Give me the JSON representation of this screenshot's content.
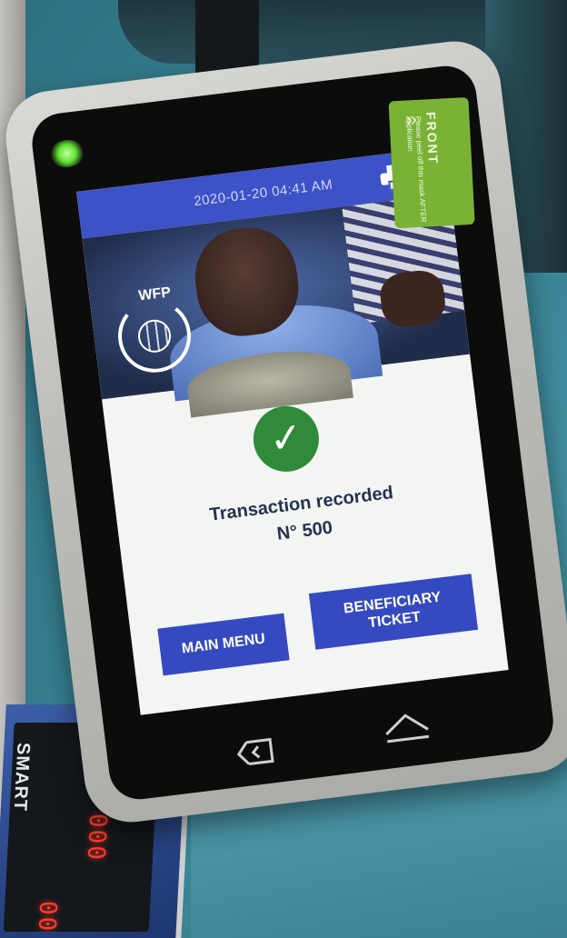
{
  "screen": {
    "datetime": "2020-01-20 04:41 AM",
    "logo_label": "WFP",
    "message": "Transaction recorded",
    "transaction_number": "N° 500",
    "buttons": {
      "main_menu": "MAIN MENU",
      "beneficiary_ticket": "BENEFICIARY TICKET"
    }
  },
  "sticker": {
    "title": "FRONT",
    "subtitle": "Please peel off this mask AFTER application"
  },
  "scale": {
    "brand": "SMART",
    "digits_top": "000",
    "digits_bottom": "00"
  },
  "icons": [
    "printer-icon",
    "check-icon",
    "back-nav-icon",
    "home-nav-icon",
    "wfp-logo-icon",
    "peel-arrow-icon"
  ],
  "colors": {
    "status_bar": "#3d52c6",
    "button": "#3549c0",
    "success": "#2f8b3a",
    "sticker": "#7ab236"
  }
}
